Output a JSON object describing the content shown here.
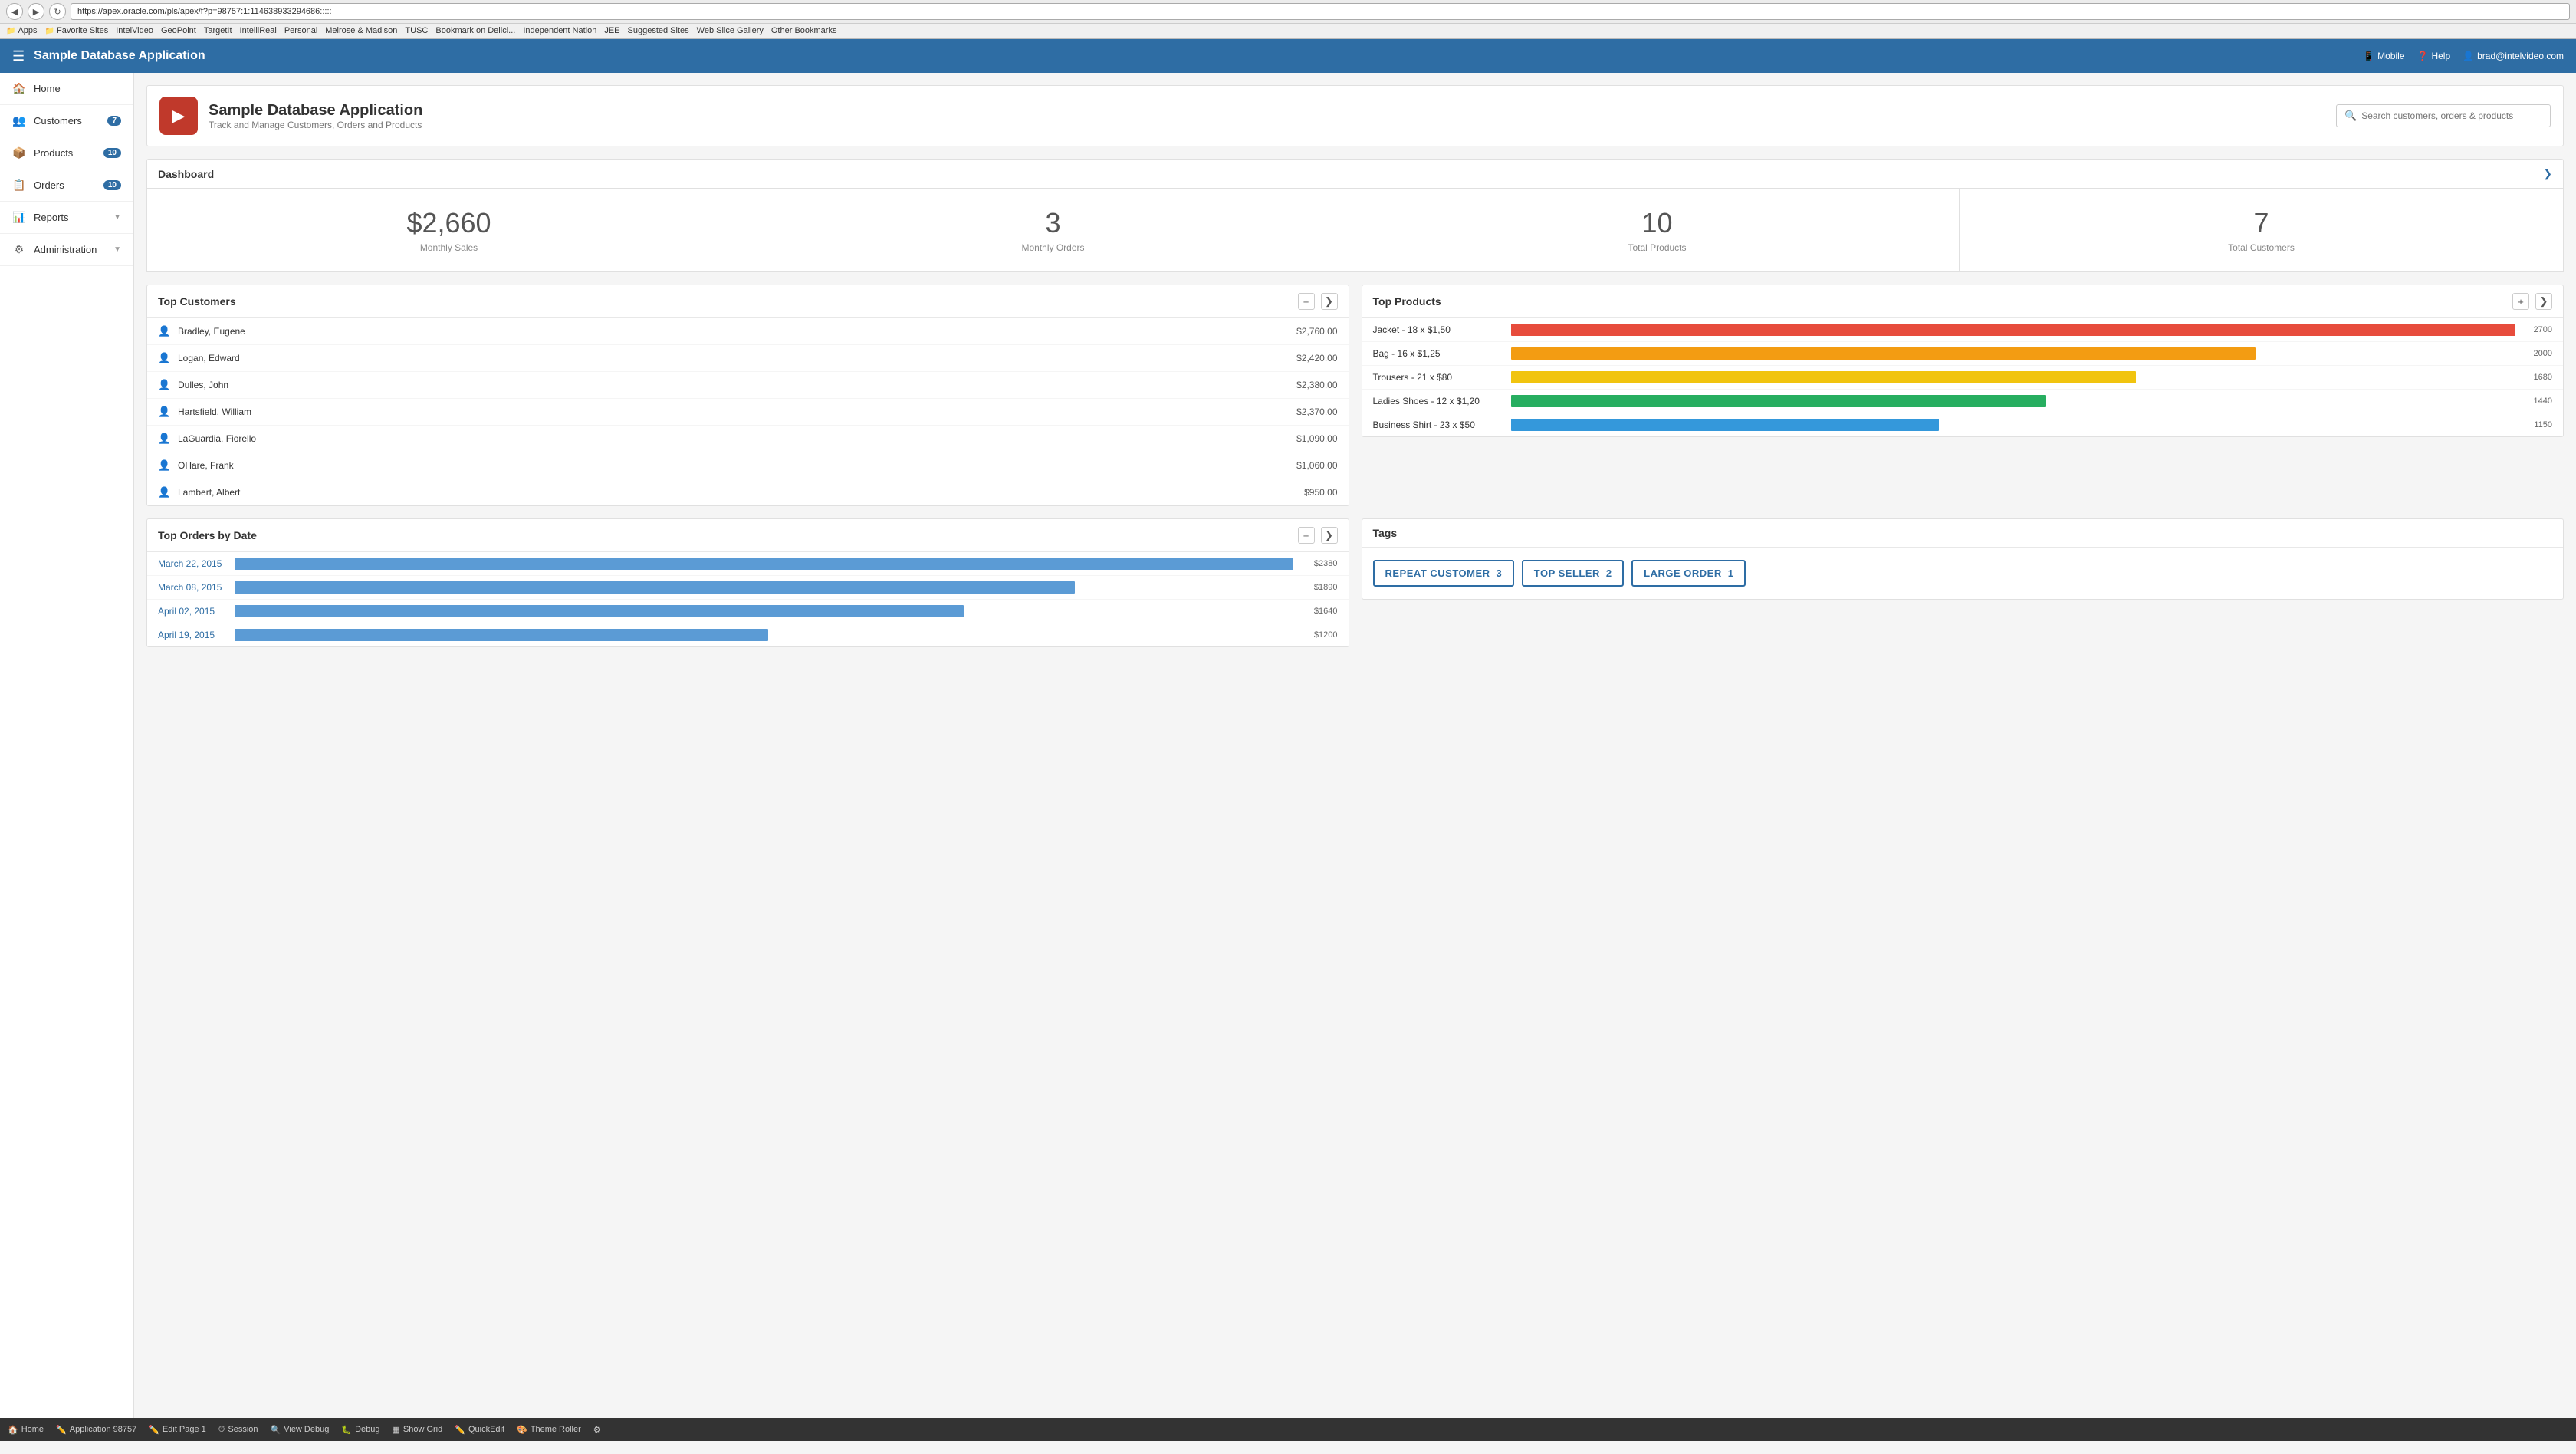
{
  "browser": {
    "url": "https://apex.oracle.com/pls/apex/f?p=98757:1:114638933294686:::::",
    "bookmarks": [
      "Apps",
      "Favorite Sites",
      "IntelVideo",
      "GeoPoint",
      "TargetIt",
      "IntelliReal",
      "Personal",
      "Melrose & Madison",
      "TUSC",
      "Bookmark on Delici...",
      "Independent Nation",
      "JEE",
      "Suggested Sites",
      "Web Slice Gallery",
      "Other Bookmarks"
    ]
  },
  "topnav": {
    "title": "Sample Database Application",
    "mobile_label": "Mobile",
    "help_label": "Help",
    "user_label": "brad@intelvideo.com"
  },
  "sidebar": {
    "home_label": "Home",
    "customers_label": "Customers",
    "customers_badge": "7",
    "products_label": "Products",
    "products_badge": "10",
    "orders_label": "Orders",
    "orders_badge": "10",
    "reports_label": "Reports",
    "administration_label": "Administration"
  },
  "app_header": {
    "title": "Sample Database Application",
    "subtitle": "Track and Manage Customers, Orders and Products",
    "search_placeholder": "Search customers, orders & products"
  },
  "dashboard": {
    "title": "Dashboard",
    "stats": [
      {
        "value": "$2,660",
        "label": "Monthly Sales"
      },
      {
        "value": "3",
        "label": "Monthly Orders"
      },
      {
        "value": "10",
        "label": "Total Products"
      },
      {
        "value": "7",
        "label": "Total Customers"
      }
    ]
  },
  "top_customers": {
    "title": "Top Customers",
    "rows": [
      {
        "name": "Bradley, Eugene",
        "amount": "$2,760.00"
      },
      {
        "name": "Logan, Edward",
        "amount": "$2,420.00"
      },
      {
        "name": "Dulles, John",
        "amount": "$2,380.00"
      },
      {
        "name": "Hartsfield, William",
        "amount": "$2,370.00"
      },
      {
        "name": "LaGuardia, Fiorello",
        "amount": "$1,090.00"
      },
      {
        "name": "OHare, Frank",
        "amount": "$1,060.00"
      },
      {
        "name": "Lambert, Albert",
        "amount": "$950.00"
      }
    ]
  },
  "top_products": {
    "title": "Top Products",
    "max_value": 2700,
    "rows": [
      {
        "label": "Jacket - 18 x $1,50",
        "value": 2700,
        "color": "#e74c3c"
      },
      {
        "label": "Bag - 16 x $1,25",
        "value": 2000,
        "color": "#f39c12"
      },
      {
        "label": "Trousers - 21 x $80",
        "value": 1680,
        "color": "#f1c40f"
      },
      {
        "label": "Ladies Shoes - 12 x $1,20",
        "value": 1440,
        "color": "#27ae60"
      },
      {
        "label": "Business Shirt - 23 x $50",
        "value": 1150,
        "color": "#3498db"
      }
    ]
  },
  "top_orders": {
    "title": "Top Orders by Date",
    "max_value": 2380,
    "rows": [
      {
        "date": "March 22, 2015",
        "value": 2380,
        "display": "$2380"
      },
      {
        "date": "March 08, 2015",
        "value": 1890,
        "display": "$1890"
      },
      {
        "date": "April 02, 2015",
        "value": 1640,
        "display": "$1640"
      },
      {
        "date": "April 19, 2015",
        "value": 1200,
        "display": "$1200"
      }
    ]
  },
  "tags": {
    "title": "Tags",
    "items": [
      {
        "label": "REPEAT CUSTOMER",
        "count": "3",
        "color": "#2e6da4"
      },
      {
        "label": "TOP SELLER",
        "count": "2",
        "color": "#2e6da4"
      },
      {
        "label": "LARGE ORDER",
        "count": "1",
        "color": "#2e6da4"
      }
    ]
  },
  "devbar": {
    "items": [
      {
        "icon": "🏠",
        "label": "Home"
      },
      {
        "icon": "✏️",
        "label": "Application 98757"
      },
      {
        "icon": "✏️",
        "label": "Edit Page 1"
      },
      {
        "icon": "⏱",
        "label": "Session"
      },
      {
        "icon": "🔍",
        "label": "View Debug"
      },
      {
        "icon": "🐛",
        "label": "Debug"
      },
      {
        "icon": "▦",
        "label": "Show Grid"
      },
      {
        "icon": "✏️",
        "label": "QuickEdit"
      },
      {
        "icon": "🎨",
        "label": "Theme Roller"
      },
      {
        "icon": "⚙",
        "label": ""
      }
    ]
  }
}
